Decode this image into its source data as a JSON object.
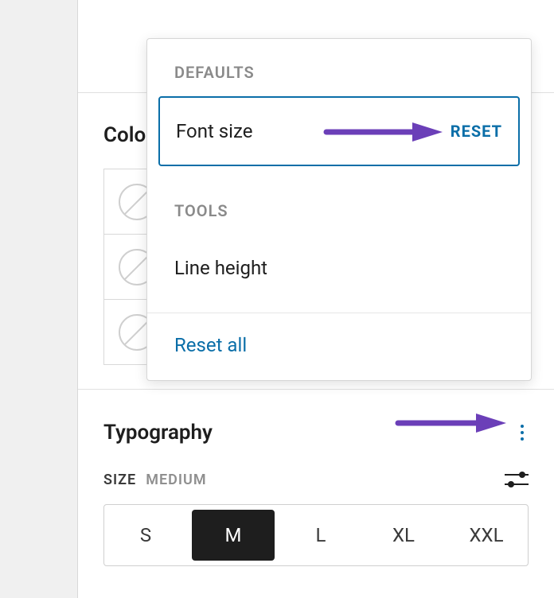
{
  "sections": {
    "color": {
      "heading": "Color"
    },
    "typography": {
      "heading": "Typography",
      "size_key": "SIZE",
      "size_value": "MEDIUM",
      "options": [
        "S",
        "M",
        "L",
        "XL",
        "XXL"
      ],
      "selected_index": 1
    }
  },
  "popover": {
    "group_defaults": "DEFAULTS",
    "font_size_label": "Font size",
    "reset_label": "RESET",
    "group_tools": "TOOLS",
    "line_height_label": "Line height",
    "reset_all_label": "Reset all"
  }
}
